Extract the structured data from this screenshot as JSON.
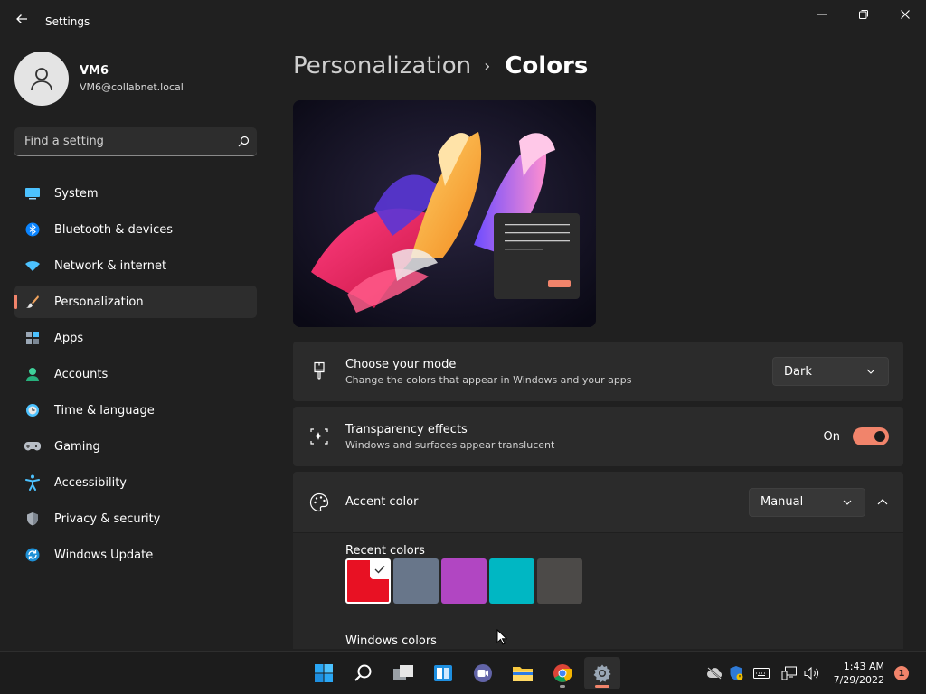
{
  "window": {
    "title": "Settings",
    "back_icon": "arrow-left-icon",
    "controls": [
      "minimize-icon",
      "restore-icon",
      "close-icon"
    ]
  },
  "profile": {
    "name": "VM6",
    "email": "VM6@collabnet.local",
    "avatar_icon": "person-icon"
  },
  "search": {
    "placeholder": "Find a setting",
    "icon": "search-icon"
  },
  "nav": {
    "items": [
      {
        "label": "System",
        "icon": "monitor-icon",
        "active": false
      },
      {
        "label": "Bluetooth & devices",
        "icon": "bluetooth-icon",
        "active": false
      },
      {
        "label": "Network & internet",
        "icon": "wifi-icon",
        "active": false
      },
      {
        "label": "Personalization",
        "icon": "brush-icon",
        "active": true
      },
      {
        "label": "Apps",
        "icon": "apps-icon",
        "active": false
      },
      {
        "label": "Accounts",
        "icon": "account-icon",
        "active": false
      },
      {
        "label": "Time & language",
        "icon": "clock-globe-icon",
        "active": false
      },
      {
        "label": "Gaming",
        "icon": "gamepad-icon",
        "active": false
      },
      {
        "label": "Accessibility",
        "icon": "accessibility-icon",
        "active": false
      },
      {
        "label": "Privacy & security",
        "icon": "shield-icon",
        "active": false
      },
      {
        "label": "Windows Update",
        "icon": "update-icon",
        "active": false
      }
    ]
  },
  "breadcrumb": {
    "parent": "Personalization",
    "separator": "›",
    "current": "Colors"
  },
  "mode": {
    "title": "Choose your mode",
    "subtitle": "Change the colors that appear in Windows and your apps",
    "value": "Dark",
    "icon": "paintbrush-icon"
  },
  "transparency": {
    "title": "Transparency effects",
    "subtitle": "Windows and surfaces appear translucent",
    "state_label": "On",
    "enabled": true,
    "icon": "sparkle-icon"
  },
  "accent": {
    "title": "Accent color",
    "value": "Manual",
    "icon": "palette-icon",
    "recent_heading": "Recent colors",
    "recent_colors": [
      "#e81123",
      "#68768a",
      "#b146c2",
      "#00b7c3",
      "#4c4a48"
    ],
    "selected_index": 0,
    "windows_heading": "Windows colors",
    "windows_colors": [
      "#ffb900",
      "#ff8c00",
      "#f7630c",
      "#ca5010",
      "#da3b01",
      "#ef6950",
      "#d13438",
      "#ff4343",
      "#e74856"
    ]
  },
  "taskbar": {
    "apps": [
      "windows-start-icon",
      "search-icon",
      "task-view-icon",
      "widgets-icon",
      "chat-icon",
      "file-explorer-icon",
      "chrome-icon",
      "settings-gear-icon"
    ],
    "tray": [
      "cloud-offline-icon",
      "defender-icon",
      "keyboard-icon",
      "network-icon",
      "volume-icon"
    ],
    "time": "1:43 AM",
    "date": "7/29/2022",
    "notification_count": "1"
  },
  "colors": {
    "accent": "#f1846b",
    "background": "#202020",
    "card": "#2b2b2b"
  }
}
